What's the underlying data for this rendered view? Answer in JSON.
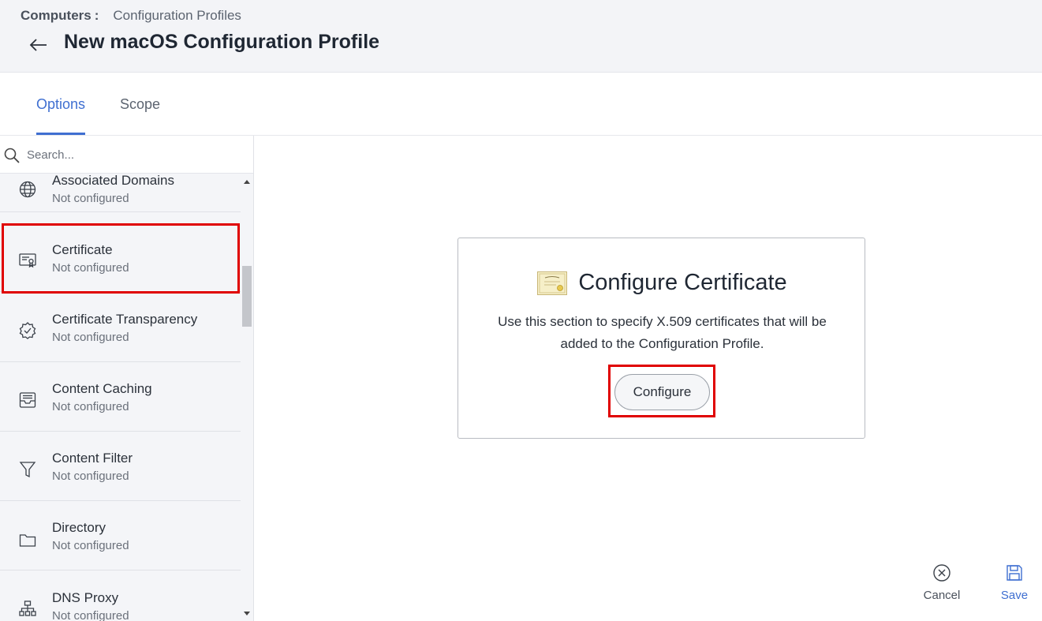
{
  "breadcrumb": {
    "root": "Computers",
    "separator": ":",
    "current": "Configuration Profiles"
  },
  "header": {
    "title": "New macOS Configuration Profile",
    "back_icon": "arrow-left-icon"
  },
  "tabs": [
    {
      "label": "Options",
      "active": true
    },
    {
      "label": "Scope",
      "active": false
    }
  ],
  "search": {
    "placeholder": "Search...",
    "value": ""
  },
  "sidebar": {
    "items": [
      {
        "name": "Associated Domains",
        "status": "Not configured",
        "icon": "globe-icon",
        "highlighted": false
      },
      {
        "name": "Certificate",
        "status": "Not configured",
        "icon": "certificate-icon",
        "highlighted": true
      },
      {
        "name": "Certificate Transparency",
        "status": "Not configured",
        "icon": "verified-badge-icon",
        "highlighted": false
      },
      {
        "name": "Content Caching",
        "status": "Not configured",
        "icon": "inbox-tray-icon",
        "highlighted": false
      },
      {
        "name": "Content Filter",
        "status": "Not configured",
        "icon": "filter-funnel-icon",
        "highlighted": false
      },
      {
        "name": "Directory",
        "status": "Not configured",
        "icon": "folder-icon",
        "highlighted": false
      },
      {
        "name": "DNS Proxy",
        "status": "Not configured",
        "icon": "network-tree-icon",
        "highlighted": false
      }
    ]
  },
  "main": {
    "card": {
      "icon": "certificate-document-icon",
      "title": "Configure Certificate",
      "description": "Use this section to specify X.509 certificates that will be added to the Configuration Profile.",
      "button_label": "Configure"
    }
  },
  "actions": {
    "cancel": {
      "label": "Cancel",
      "icon": "close-circle-icon"
    },
    "save": {
      "label": "Save",
      "icon": "floppy-disk-icon"
    }
  },
  "colors": {
    "accent": "#3f6fd1",
    "highlight": "#e00000",
    "header_bg": "#f3f4f7",
    "sidebar_bg": "#f4f5f8"
  }
}
